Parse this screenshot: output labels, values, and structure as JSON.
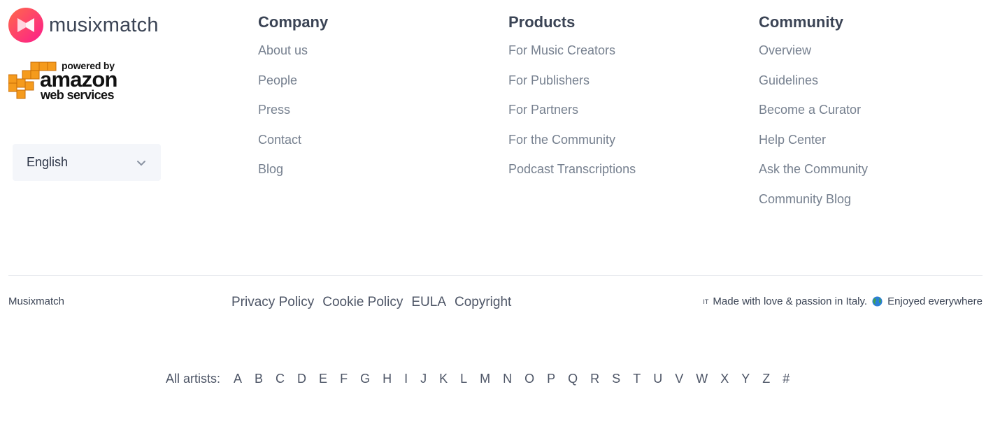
{
  "brand": {
    "name": "musixmatch",
    "logo_icon": "musixmatch-logo-icon",
    "colors": {
      "brand_gradient_start": "#ff6050",
      "brand_gradient_end": "#fc1c8c",
      "text_dark": "#3b4455",
      "link_gray": "#76808f"
    }
  },
  "aws_badge": {
    "powered": "powered by",
    "amazon": "amazon",
    "web_services": "web services",
    "cube_color": "#f59b1d"
  },
  "language": {
    "selected": "English",
    "icon": "chevron-down-icon"
  },
  "columns": {
    "company": {
      "title": "Company",
      "links": [
        "About us",
        "People",
        "Press",
        "Contact",
        "Blog"
      ]
    },
    "products": {
      "title": "Products",
      "links": [
        "For Music Creators",
        "For Publishers",
        "For Partners",
        "For the Community",
        "Podcast Transcriptions"
      ]
    },
    "community": {
      "title": "Community",
      "links": [
        "Overview",
        "Guidelines",
        "Become a Curator",
        "Help Center",
        "Ask the Community",
        "Community Blog"
      ]
    }
  },
  "bottom": {
    "brand": "Musixmatch",
    "legal_links": [
      "Privacy Policy",
      "Cookie Policy",
      "EULA",
      "Copyright"
    ],
    "flag_text": "IT",
    "made_in": "Made with love & passion in Italy.",
    "globe_icon": "globe-icon",
    "enjoyed": "Enjoyed everywhere"
  },
  "artists": {
    "label": "All artists:",
    "letters": [
      "A",
      "B",
      "C",
      "D",
      "E",
      "F",
      "G",
      "H",
      "I",
      "J",
      "K",
      "L",
      "M",
      "N",
      "O",
      "P",
      "Q",
      "R",
      "S",
      "T",
      "U",
      "V",
      "W",
      "X",
      "Y",
      "Z",
      "#"
    ]
  }
}
